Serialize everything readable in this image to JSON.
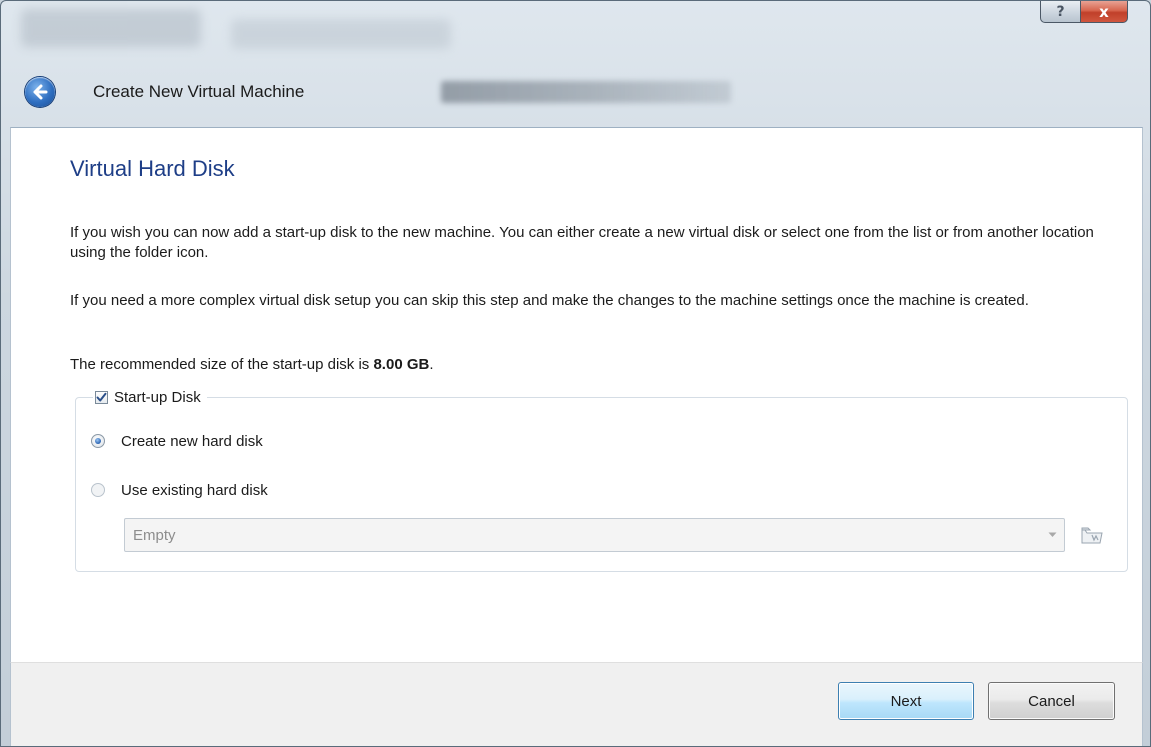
{
  "window": {
    "title_buttons": {
      "help_glyph": "?",
      "close_glyph": "x"
    }
  },
  "wizard": {
    "title": "Create New Virtual Machine",
    "back_icon": "back-arrow-icon"
  },
  "page": {
    "heading": "Virtual Hard Disk",
    "description_1": "If you wish you can now add a start-up disk to the new machine. You can either create a new virtual disk or select one from the list or from another location using the folder icon.",
    "description_2": "If you need a more complex virtual disk setup you can skip this step and make the changes to the machine settings once the machine is created.",
    "recommended_prefix": "The recommended size of the start-up disk is ",
    "recommended_size": "8.00 GB",
    "recommended_suffix": "."
  },
  "startup_disk": {
    "label": "Start-up Disk",
    "checked": true,
    "options": [
      {
        "label": "Create new hard disk",
        "selected": true
      },
      {
        "label": "Use existing hard disk",
        "selected": false
      }
    ],
    "existing_disk_combo": {
      "value": "Empty",
      "enabled": false
    },
    "folder_icon": "folder-icon"
  },
  "buttons": {
    "next": "Next",
    "cancel": "Cancel"
  },
  "colors": {
    "heading": "#1e3e87",
    "close_button": "#c0402a",
    "default_button_border": "#3c7fb1"
  }
}
